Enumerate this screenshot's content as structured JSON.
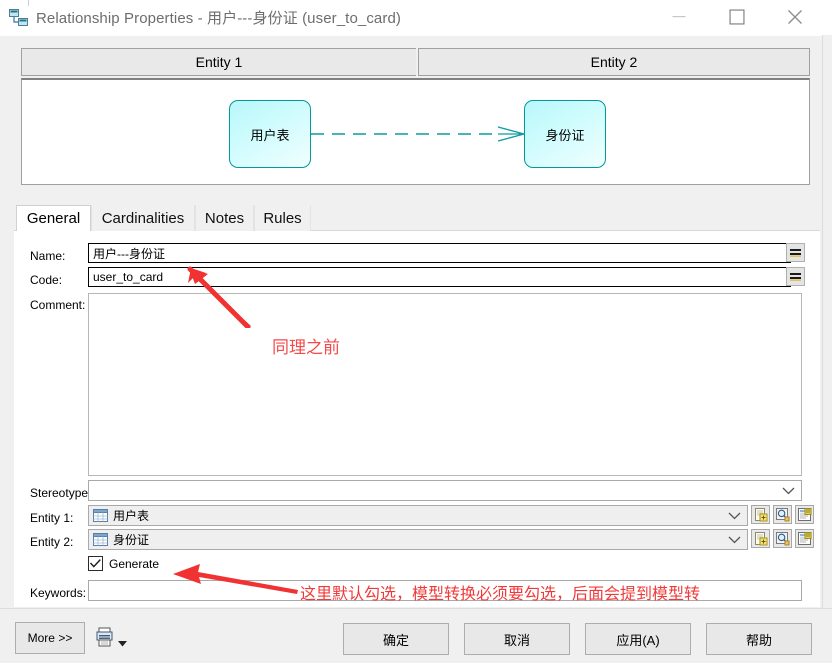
{
  "window": {
    "title": "Relationship Properties - 用户---身份证 (user_to_card)",
    "icon": "relationship-icon",
    "minimize_label": "—",
    "maximize_label": "□",
    "close_label": "✕"
  },
  "entity_header": {
    "entity1": "Entity 1",
    "entity2": "Entity 2"
  },
  "diagram": {
    "entity1_name": "用户表",
    "entity2_name": "身份证",
    "line_color": "#0d9ba1",
    "box_fill": "#cdfcfd",
    "box_border": "#009a9a",
    "notation": "crow-foot"
  },
  "tabs": [
    {
      "label": "General",
      "active": true
    },
    {
      "label": "Cardinalities",
      "active": false
    },
    {
      "label": "Notes",
      "active": false
    },
    {
      "label": "Rules",
      "active": false
    }
  ],
  "form": {
    "name_label": "Name:",
    "name_value": "用户---身份证",
    "name_placeholder": "",
    "code_label": "Code:",
    "code_value": "user_to_card",
    "code_placeholder": "",
    "equals_button_label": "=",
    "comment_label": "Comment:",
    "comment_value": "",
    "stereotype_label": "Stereotype:",
    "stereotype_value": "",
    "entity1_label": "Entity 1:",
    "entity1_value": "用户表",
    "entity2_label": "Entity 2:",
    "entity2_value": "身份证",
    "generate_label": "Generate",
    "generate_checked": true,
    "keywords_label": "Keywords:",
    "keywords_value": ""
  },
  "row_tools": {
    "create_icon": "new-object-icon",
    "find_icon": "magnifier-icon",
    "properties_icon": "properties-icon"
  },
  "bottom": {
    "more_label": "More >>",
    "print_icon": "print-icon",
    "print_caret": "caret-down-icon",
    "ok_label": "确定",
    "cancel_label": "取消",
    "apply_label": "应用(A)",
    "help_label": "帮助"
  },
  "annotations": {
    "comment_note": "同理之前",
    "generate_note": "这里默认勾选，模型转换必须要勾选，后面会提到模型转",
    "color": "#f03a3a",
    "arrow_code_target": "code-field",
    "arrow_generate_target": "generate-checkbox"
  }
}
